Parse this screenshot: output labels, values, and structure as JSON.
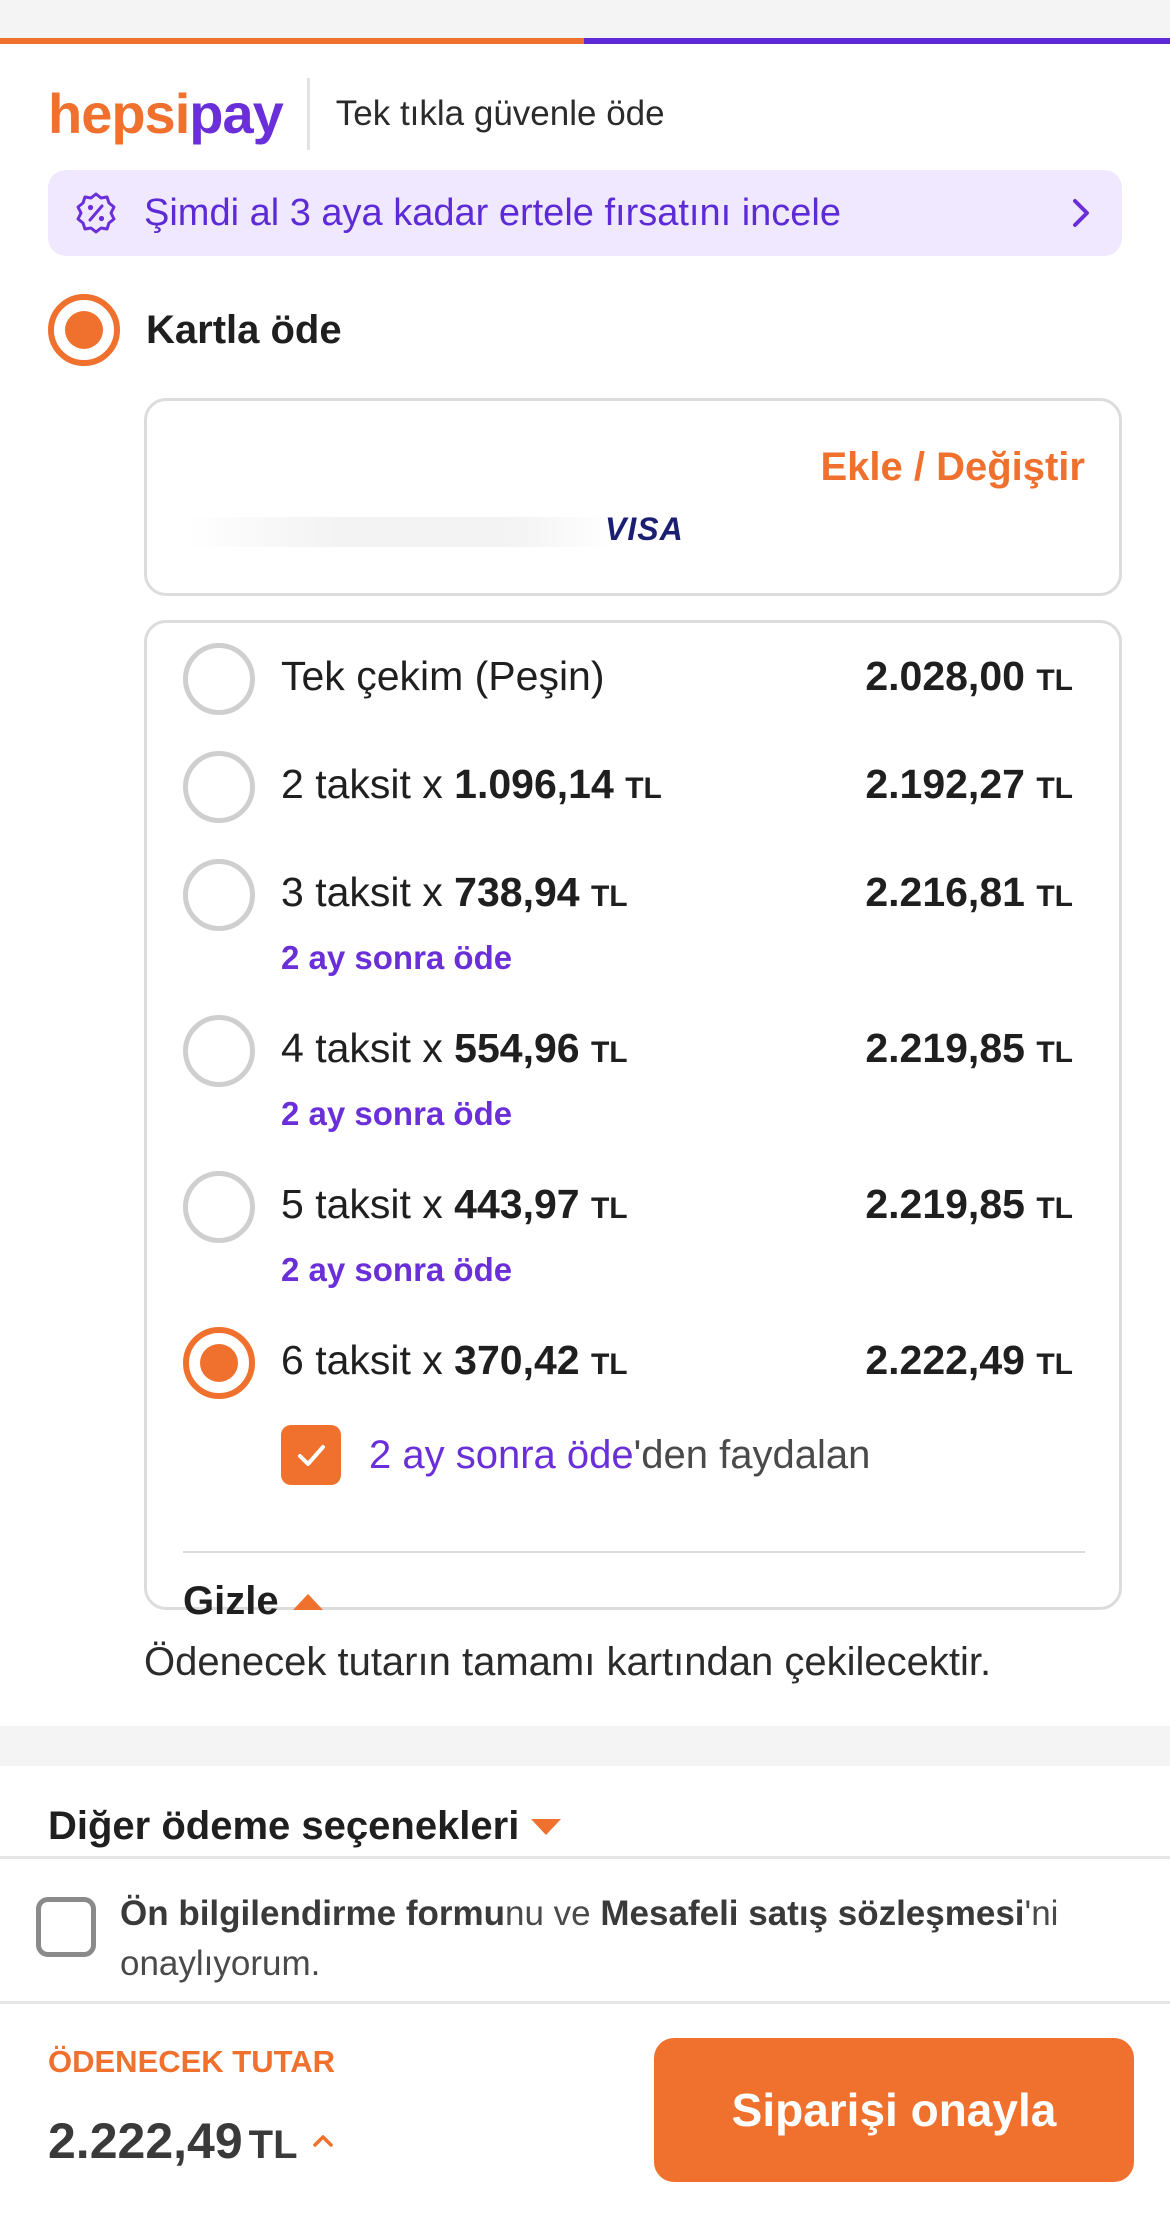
{
  "brand": {
    "logo_hepsi": "hepsi",
    "logo_pay": "pay",
    "tagline": "Tek tıkla güvenle öde",
    "colors": {
      "orange": "#f0702d",
      "purple": "#6a2fd9"
    }
  },
  "promo": {
    "icon": "badge-percent-icon",
    "text": "Şimdi al 3 aya kadar ertele fırsatını incele"
  },
  "payment_method": {
    "label": "Kartla öde",
    "selected": true
  },
  "card": {
    "change_label": "Ekle / Değiştir",
    "network": "VISA"
  },
  "installments": [
    {
      "label": "Tek çekim (Peşin)",
      "count_text": "",
      "monthly": "",
      "total": "2.028,00",
      "currency": "TL",
      "sub": "",
      "selected": false
    },
    {
      "label": "",
      "count_text": "2 taksit x ",
      "monthly": "1.096,14",
      "total": "2.192,27",
      "currency": "TL",
      "sub": "",
      "selected": false
    },
    {
      "label": "",
      "count_text": "3 taksit x ",
      "monthly": "738,94",
      "total": "2.216,81",
      "currency": "TL",
      "sub": "2 ay sonra öde",
      "selected": false
    },
    {
      "label": "",
      "count_text": "4 taksit x ",
      "monthly": "554,96",
      "total": "2.219,85",
      "currency": "TL",
      "sub": "2 ay sonra öde",
      "selected": false
    },
    {
      "label": "",
      "count_text": "5 taksit x ",
      "monthly": "443,97",
      "total": "2.219,85",
      "currency": "TL",
      "sub": "2 ay sonra öde",
      "selected": false
    },
    {
      "label": "",
      "count_text": "6 taksit x ",
      "monthly": "370,42",
      "total": "2.222,49",
      "currency": "TL",
      "sub": "",
      "selected": true
    }
  ],
  "defer_option": {
    "checked": true,
    "highlight": "2 ay sonra öde",
    "rest": "'den faydalan"
  },
  "hide_label": "Gizle",
  "note": "Ödenecek tutarın tamamı kartından çekilecektir.",
  "other_options": {
    "label": "Diğer ödeme seçenekleri"
  },
  "consent": {
    "checked": false,
    "part1_bold": "Ön bilgilendirme formu",
    "part2": "nu ve ",
    "part3_bold": "Mesafeli satış sözleşmesi",
    "part4": "'ni onaylıyorum."
  },
  "footer": {
    "due_label": "ÖDENECEK TUTAR",
    "due_amount": "2.222,49",
    "due_currency": "TL",
    "confirm_label": "Siparişi onayla"
  }
}
